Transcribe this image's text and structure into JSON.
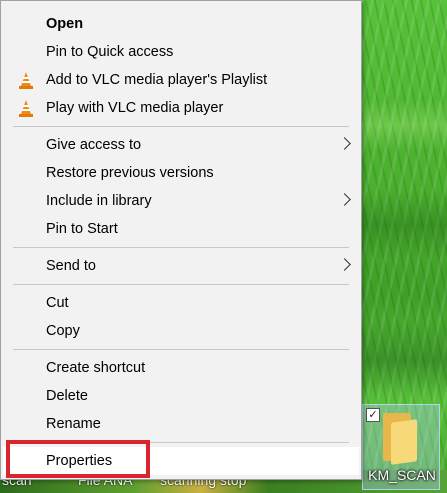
{
  "menu": {
    "items": [
      {
        "label": "Open",
        "bold": true
      },
      {
        "label": "Pin to Quick access"
      },
      {
        "label": "Add to VLC media player's Playlist",
        "icon": "vlc-cone-icon"
      },
      {
        "label": "Play with VLC media player",
        "icon": "vlc-cone-icon"
      },
      {
        "label": "Give access to",
        "submenu": true
      },
      {
        "label": "Restore previous versions"
      },
      {
        "label": "Include in library",
        "submenu": true
      },
      {
        "label": "Pin to Start"
      },
      {
        "label": "Send to",
        "submenu": true
      },
      {
        "label": "Cut"
      },
      {
        "label": "Copy"
      },
      {
        "label": "Create shortcut"
      },
      {
        "label": "Delete"
      },
      {
        "label": "Rename"
      },
      {
        "label": "Properties",
        "highlighted": true
      }
    ]
  },
  "desktop": {
    "icon_label": "KM_SCAN",
    "stray_labels": [
      "scan",
      "File ANA",
      "scanning stop"
    ]
  },
  "colors": {
    "menu_bg": "#f2f2f2",
    "highlight_border": "#d9262c",
    "vlc_orange": "#f28a12"
  }
}
